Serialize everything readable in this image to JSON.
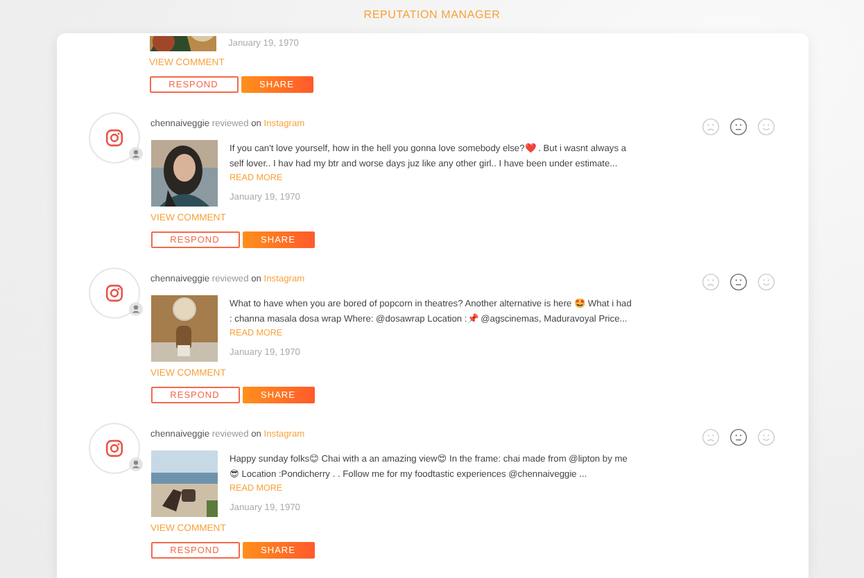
{
  "header": {
    "title": "REPUTATION MANAGER"
  },
  "partial_review": {
    "date": "January 19, 1970",
    "view_comment": "VIEW COMMENT",
    "respond": "RESPOND",
    "share": "SHARE"
  },
  "reviews": [
    {
      "user": "chennaiveggie",
      "verb": "reviewed",
      "on": "on",
      "platform": "Instagram",
      "text": "If you can't love yourself, how in the hell you gonna love somebody else?❤️ . But i wasnt always a self lover.. I hav had my btr and worse days juz like any other girl.. I have been under estimate...",
      "read_more": "READ MORE",
      "date": "January 19, 1970",
      "view_comment": "VIEW COMMENT",
      "respond": "RESPOND",
      "share": "SHARE",
      "sentiment": [
        {
          "kind": "sad",
          "selected": false
        },
        {
          "kind": "neutral",
          "selected": true
        },
        {
          "kind": "happy",
          "selected": false
        }
      ]
    },
    {
      "user": "chennaiveggie",
      "verb": "reviewed",
      "on": "on",
      "platform": "Instagram",
      "text": "What to have when you are bored of popcorn in theatres? Another alternative is here 🤩 What i had : channa masala dosa wrap Where: @dosawrap Location :📌 @agscinemas, Maduravoyal Price...",
      "read_more": "READ MORE",
      "date": "January 19, 1970",
      "view_comment": "VIEW COMMENT",
      "respond": "RESPOND",
      "share": "SHARE",
      "sentiment": [
        {
          "kind": "sad",
          "selected": false
        },
        {
          "kind": "neutral",
          "selected": true
        },
        {
          "kind": "happy",
          "selected": false
        }
      ]
    },
    {
      "user": "chennaiveggie",
      "verb": "reviewed",
      "on": "on",
      "platform": "Instagram",
      "text": "Happy sunday folks😊 Chai with a an amazing view😍 In the frame: chai made from @lipton by me 😎 Location :Pondicherry . . Follow me for my foodtastic experiences @chennaiveggie ...",
      "read_more": "READ MORE",
      "date": "January 19, 1970",
      "view_comment": "VIEW COMMENT",
      "respond": "RESPOND",
      "share": "SHARE",
      "sentiment": [
        {
          "kind": "sad",
          "selected": false
        },
        {
          "kind": "neutral",
          "selected": true
        },
        {
          "kind": "happy",
          "selected": false
        }
      ]
    }
  ]
}
